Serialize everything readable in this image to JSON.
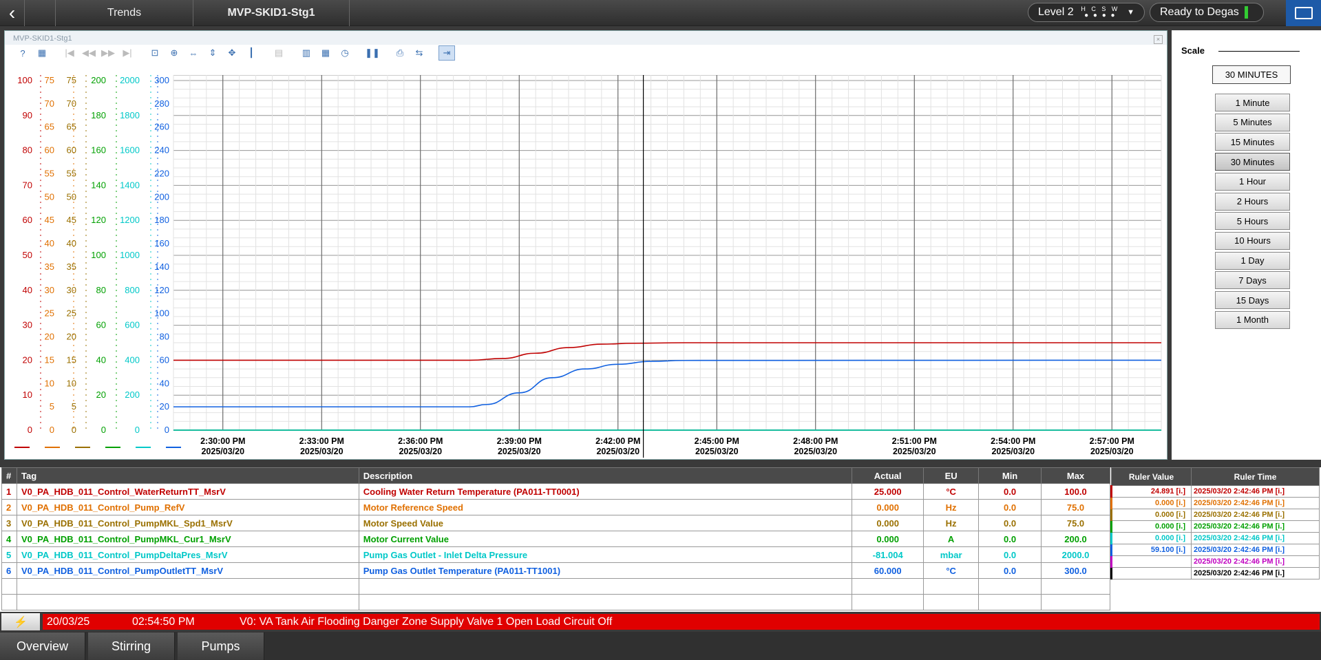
{
  "header": {
    "back_icon": "chevron-left-icon",
    "breadcrumb": [
      "Trends",
      "MVP-SKID1-Stg1"
    ],
    "level_label": "Level 2",
    "level_letters": "H C S W",
    "level_dots": "● ● ● ●",
    "status": "Ready to Degas",
    "monitor_icon": "monitor-icon"
  },
  "trend_window": {
    "title": "MVP-SKID1-Stg1",
    "close_label": "×"
  },
  "toolbar": [
    {
      "name": "help",
      "glyph": "?"
    },
    {
      "name": "settings",
      "glyph": "▦"
    },
    {
      "name": "first",
      "glyph": "|◀",
      "dim": true
    },
    {
      "name": "prev-fast",
      "glyph": "◀◀",
      "dim": true
    },
    {
      "name": "next-fast",
      "glyph": "▶▶",
      "dim": true
    },
    {
      "name": "last",
      "glyph": "▶|",
      "dim": true
    },
    {
      "name": "zoom-box",
      "glyph": "⊡"
    },
    {
      "name": "zoom-in",
      "glyph": "⊕"
    },
    {
      "name": "zoom-horizontal",
      "glyph": "⇔"
    },
    {
      "name": "zoom-vertical",
      "glyph": "⇕"
    },
    {
      "name": "pan",
      "glyph": "✥"
    },
    {
      "name": "ruler",
      "glyph": "┃"
    },
    {
      "name": "table",
      "glyph": "▤",
      "dim": true
    },
    {
      "name": "axis-config",
      "glyph": "▥"
    },
    {
      "name": "grid-config",
      "glyph": "▦"
    },
    {
      "name": "timer",
      "glyph": "◷"
    },
    {
      "name": "pause",
      "glyph": "❚❚"
    },
    {
      "name": "print",
      "glyph": "⎙"
    },
    {
      "name": "export",
      "glyph": "⇆"
    },
    {
      "name": "ruler-mode",
      "glyph": "⇥",
      "active": true
    }
  ],
  "chart_data": {
    "type": "line",
    "x_labels": [
      {
        "time": "2:30:00 PM",
        "date": "2025/03/20"
      },
      {
        "time": "2:33:00 PM",
        "date": "2025/03/20"
      },
      {
        "time": "2:36:00 PM",
        "date": "2025/03/20"
      },
      {
        "time": "2:39:00 PM",
        "date": "2025/03/20"
      },
      {
        "time": "2:42:00 PM",
        "date": "2025/03/20"
      },
      {
        "time": "2:45:00 PM",
        "date": "2025/03/20"
      },
      {
        "time": "2:48:00 PM",
        "date": "2025/03/20"
      },
      {
        "time": "2:51:00 PM",
        "date": "2025/03/20"
      },
      {
        "time": "2:54:00 PM",
        "date": "2025/03/20"
      },
      {
        "time": "2:57:00 PM",
        "date": "2025/03/20"
      }
    ],
    "x_range_minutes": [
      -1.5,
      28.5
    ],
    "ruler_minute": 12.77,
    "axes": [
      {
        "color": "#c00000",
        "ylim": [
          0,
          100
        ],
        "ticks": [
          0,
          10,
          20,
          30,
          40,
          50,
          60,
          70,
          80,
          90,
          100
        ]
      },
      {
        "color": "#e07000",
        "ylim": [
          0,
          75
        ],
        "ticks": [
          0,
          5,
          10,
          15,
          20,
          25,
          30,
          35,
          40,
          45,
          50,
          55,
          60,
          65,
          70,
          75
        ]
      },
      {
        "color": "#9a7000",
        "ylim": [
          0,
          75
        ],
        "ticks": [
          0,
          5,
          10,
          15,
          20,
          25,
          30,
          35,
          40,
          45,
          50,
          55,
          60,
          65,
          70,
          75
        ]
      },
      {
        "color": "#00a000",
        "ylim": [
          0,
          200
        ],
        "ticks": [
          0,
          20,
          40,
          60,
          80,
          100,
          120,
          140,
          160,
          180,
          200
        ]
      },
      {
        "color": "#00c8c8",
        "ylim": [
          0,
          2000
        ],
        "ticks": [
          0,
          200,
          400,
          600,
          800,
          1000,
          1200,
          1400,
          1600,
          1800,
          2000
        ]
      },
      {
        "color": "#1060e0",
        "ylim": [
          0,
          300
        ],
        "ticks": [
          0,
          20,
          40,
          60,
          80,
          100,
          120,
          140,
          160,
          180,
          200,
          220,
          240,
          260,
          280,
          300
        ]
      }
    ],
    "series": [
      {
        "name": "V0_PA_HDB_011_Control_WaterReturnTT_MsrV",
        "color": "#c00000",
        "axis": 0,
        "points": [
          [
            -1.5,
            20
          ],
          [
            7.5,
            20
          ],
          [
            8.5,
            20.5
          ],
          [
            9.5,
            22
          ],
          [
            10.5,
            23.6
          ],
          [
            11.5,
            24.6
          ],
          [
            12.5,
            24.85
          ],
          [
            14,
            25
          ],
          [
            28.5,
            25
          ]
        ]
      },
      {
        "name": "V0_PA_HDB_011_Control_Pump_RefV",
        "color": "#e07000",
        "axis": 1,
        "points": [
          [
            -1.5,
            0
          ],
          [
            28.5,
            0
          ]
        ]
      },
      {
        "name": "V0_PA_HDB_011_Control_PumpMKL_Spd1_MsrV",
        "color": "#9a7000",
        "axis": 2,
        "points": [
          [
            -1.5,
            0
          ],
          [
            28.5,
            0
          ]
        ]
      },
      {
        "name": "V0_PA_HDB_011_Control_PumpMKL_Cur1_MsrV",
        "color": "#00a000",
        "axis": 3,
        "points": [
          [
            -1.5,
            0
          ],
          [
            28.5,
            0
          ]
        ]
      },
      {
        "name": "V0_PA_HDB_011_Control_PumpDeltaPres_MsrV",
        "color": "#00c8c8",
        "axis": 4,
        "points": [
          [
            -1.5,
            0
          ],
          [
            28.5,
            0
          ]
        ]
      },
      {
        "name": "V0_PA_HDB_011_Control_PumpOutletTT_MsrV",
        "color": "#1060e0",
        "axis": 5,
        "points": [
          [
            -1.5,
            20
          ],
          [
            7.5,
            20
          ],
          [
            8.0,
            22
          ],
          [
            9.0,
            32
          ],
          [
            10.0,
            45
          ],
          [
            11.0,
            52.5
          ],
          [
            12.0,
            56.5
          ],
          [
            13.0,
            59
          ],
          [
            14.0,
            59.8
          ],
          [
            28.5,
            60
          ]
        ]
      }
    ]
  },
  "scale": {
    "title": "Scale",
    "current": "30 MINUTES",
    "options": [
      "1 Minute",
      "5 Minutes",
      "15 Minutes",
      "30 Minutes",
      "1 Hour",
      "2 Hours",
      "5 Hours",
      "10 Hours",
      "1 Day",
      "7 Days",
      "15 Days",
      "1 Month"
    ],
    "selected_index": 3
  },
  "tag_table": {
    "headers": [
      "#",
      "Tag",
      "Description",
      "Actual",
      "EU",
      "Min",
      "Max"
    ],
    "rows": [
      {
        "num": "1",
        "tag": "V0_PA_HDB_011_Control_WaterReturnTT_MsrV",
        "desc": "Cooling Water Return Temperature (PA011-TT0001)",
        "actual": "25.000",
        "eu": "°C",
        "min": "0.0",
        "max": "100.0",
        "color": "#c00000"
      },
      {
        "num": "2",
        "tag": "V0_PA_HDB_011_Control_Pump_RefV",
        "desc": "Motor Reference Speed",
        "actual": "0.000",
        "eu": "Hz",
        "min": "0.0",
        "max": "75.0",
        "color": "#e07000"
      },
      {
        "num": "3",
        "tag": "V0_PA_HDB_011_Control_PumpMKL_Spd1_MsrV",
        "desc": "Motor Speed Value",
        "actual": "0.000",
        "eu": "Hz",
        "min": "0.0",
        "max": "75.0",
        "color": "#9a7000"
      },
      {
        "num": "4",
        "tag": "V0_PA_HDB_011_Control_PumpMKL_Cur1_MsrV",
        "desc": "Motor Current Value",
        "actual": "0.000",
        "eu": "A",
        "min": "0.0",
        "max": "200.0",
        "color": "#00a000"
      },
      {
        "num": "5",
        "tag": "V0_PA_HDB_011_Control_PumpDeltaPres_MsrV",
        "desc": "Pump Gas Outlet - Inlet Delta Pressure",
        "actual": "-81.004",
        "eu": "mbar",
        "min": "0.0",
        "max": "2000.0",
        "color": "#00c8c8"
      },
      {
        "num": "6",
        "tag": "V0_PA_HDB_011_Control_PumpOutletTT_MsrV",
        "desc": "Pump Gas Outlet Temperature (PA011-TT1001)",
        "actual": "60.000",
        "eu": "°C",
        "min": "0.0",
        "max": "300.0",
        "color": "#1060e0"
      }
    ]
  },
  "ruler_table": {
    "headers": [
      "Ruler Value",
      "Ruler Time"
    ],
    "rows": [
      {
        "value": "24.891 [i.]",
        "time": "2025/03/20 2:42:46 PM [i.]",
        "color": "#c00000"
      },
      {
        "value": "0.000 [i.]",
        "time": "2025/03/20 2:42:46 PM [i.]",
        "color": "#e07000"
      },
      {
        "value": "0.000 [i.]",
        "time": "2025/03/20 2:42:46 PM [i.]",
        "color": "#9a7000"
      },
      {
        "value": "0.000 [i.]",
        "time": "2025/03/20 2:42:46 PM [i.]",
        "color": "#00a000"
      },
      {
        "value": "0.000 [i.]",
        "time": "2025/03/20 2:42:46 PM [i.]",
        "color": "#00c8c8"
      },
      {
        "value": "59.100 [i.]",
        "time": "2025/03/20 2:42:46 PM [i.]",
        "color": "#1060e0"
      },
      {
        "value": "",
        "time": "2025/03/20 2:42:46 PM [i.]",
        "color": "#c000c0"
      },
      {
        "value": "",
        "time": "2025/03/20 2:42:46 PM [i.]",
        "color": "#000000"
      }
    ]
  },
  "alarm": {
    "icon": "lightning-icon",
    "date": "20/03/25",
    "time": "02:54:50 PM",
    "message": "V0: VA Tank Air Flooding Danger Zone Supply Valve 1 Open Load Circuit Off"
  },
  "nav_tabs": [
    "Overview",
    "Stirring",
    "Pumps"
  ]
}
